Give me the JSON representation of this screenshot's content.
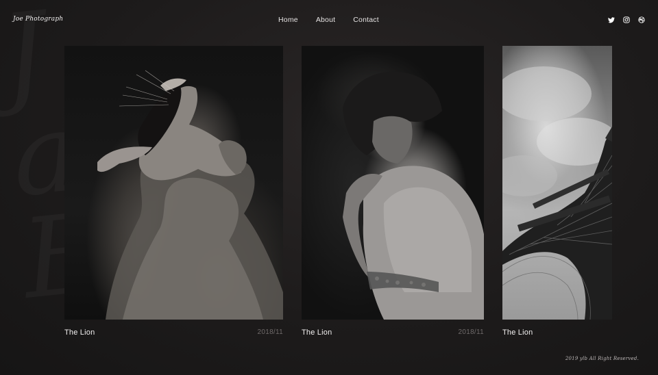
{
  "brand": "Joe Photograph",
  "nav": [
    "Home",
    "About",
    "Contact"
  ],
  "social_icons": [
    "twitter-icon",
    "instagram-icon",
    "dribbble-icon"
  ],
  "gallery": [
    {
      "title": "The Lion",
      "date": "2018/11",
      "image": "lioness-roaring-bw"
    },
    {
      "title": "The Lion",
      "date": "2018/11",
      "image": "woman-bare-shoulder-bw"
    },
    {
      "title": "The Lion",
      "date": "",
      "image": "eiffel-tower-bw"
    }
  ],
  "footer": "2019 ylb  All Right Reserved.",
  "colors": {
    "background": "#1d1b1b",
    "text": "#f2f0f0",
    "muted": "#6f6a6a"
  }
}
